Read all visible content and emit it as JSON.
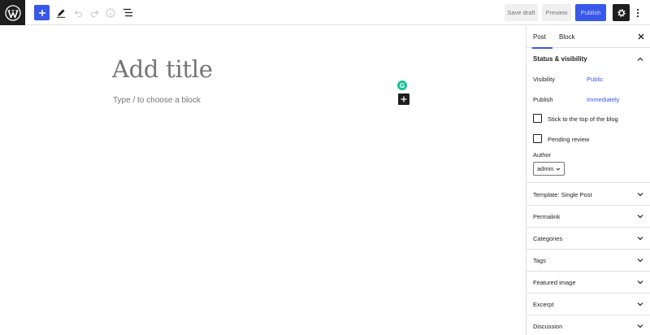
{
  "toolbar": {
    "save_draft": "Save draft",
    "preview": "Preview",
    "publish": "Publish",
    "accent": "#3858e9",
    "icons": [
      "wordpress-logo-icon",
      "plus-icon",
      "pencil-icon",
      "undo-icon",
      "redo-icon",
      "info-icon",
      "list-view-icon",
      "gear-icon",
      "more-vertical-icon"
    ]
  },
  "editor": {
    "title_placeholder": "Add title",
    "block_placeholder": "Type / to choose a block",
    "grammarly_letter": "G"
  },
  "sidebar": {
    "tabs": [
      "Post",
      "Block"
    ],
    "status_panel": {
      "title": "Status & visibility",
      "visibility_label": "Visibility",
      "visibility_value": "Public",
      "publish_label": "Publish",
      "publish_value": "Immediately",
      "sticky_label": "Stick to the top of the blog",
      "pending_label": "Pending review",
      "author_label": "Author",
      "author_value": "admin"
    },
    "panels": [
      "Template: Single Post",
      "Permalink",
      "Categories",
      "Tags",
      "Featured image",
      "Excerpt",
      "Discussion"
    ]
  }
}
